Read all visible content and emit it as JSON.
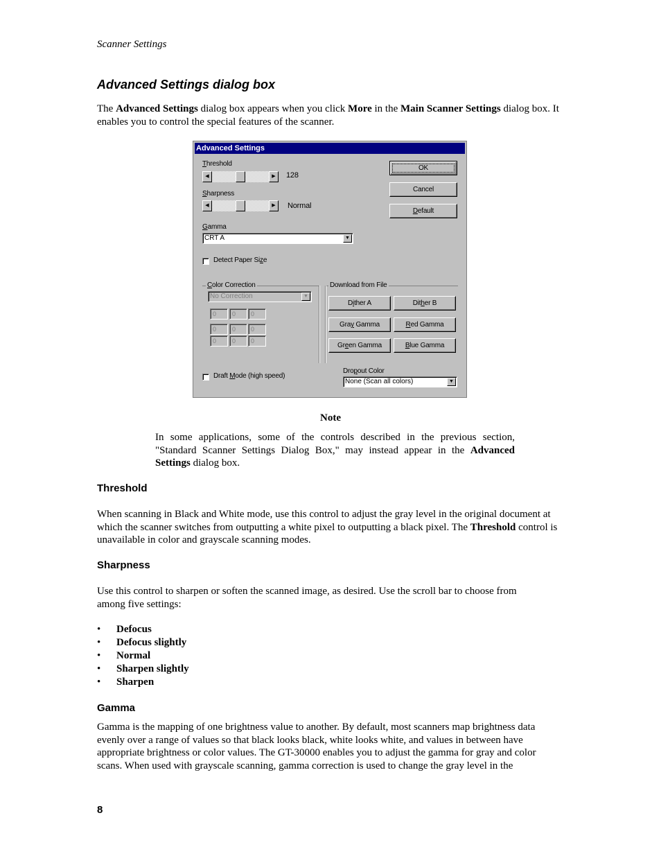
{
  "page": {
    "running_head": "Scanner Settings",
    "section_title": "Advanced Settings dialog box",
    "intro": {
      "p1": "The ",
      "b1": "Advanced Settings",
      "p2": " dialog box appears when you click ",
      "b2": "More",
      "p3": " in the ",
      "b3": "Main Scanner Settings",
      "p4": " dialog box. It enables you to control the special features of the scanner."
    },
    "note": {
      "title": "Note",
      "p1": "In some applications, some of the controls described in the previous section, \"Standard Scanner Settings Dialog Box,\" may instead appear in the ",
      "b1": "Advanced Settings",
      "p2": " dialog box."
    },
    "threshold": {
      "heading": "Threshold",
      "p1": "When scanning in Black and White mode, use this control to adjust the gray level in the original document at which the scanner switches from outputting a white pixel to outputting a black pixel. The ",
      "b1": "Threshold",
      "p2": " control is unavailable in color and grayscale scanning modes."
    },
    "sharpness": {
      "heading": "Sharpness",
      "text": "Use this control to sharpen or soften the scanned image, as desired. Use the scroll bar to choose from among five settings:",
      "options": [
        "Defocus",
        "Defocus slightly",
        "Normal",
        "Sharpen slightly",
        "Sharpen"
      ]
    },
    "gamma": {
      "heading": "Gamma",
      "text": "Gamma is the mapping of one brightness value to another. By default, most scanners map brightness data evenly over a range of values so that black looks black, white looks white, and values in between have appropriate brightness or color values. The GT-30000 enables you to adjust the gamma for gray and color scans. When used with grayscale scanning, gamma correction is used to change the gray level in the"
    },
    "page_number": "8"
  },
  "dialog": {
    "title": "Advanced Settings",
    "title_bar_color": "#000080",
    "face_color": "#c0c0c0",
    "threshold": {
      "label_u": "T",
      "label_rest": "hreshold",
      "value": "128",
      "position_fraction": 0.5
    },
    "sharpness": {
      "label_u": "S",
      "label_rest": "harpness",
      "value": "Normal",
      "position_fraction": 0.5
    },
    "gamma": {
      "label_u": "G",
      "label_rest": "amma",
      "selected": "CRT A"
    },
    "detect_paper_size": {
      "label_pre": "Detect Paper Si",
      "label_u": "z",
      "label_post": "e",
      "checked": false
    },
    "buttons": {
      "ok": "OK",
      "cancel": "Cancel",
      "default_u": "D",
      "default_rest": "efault"
    },
    "color_correction": {
      "label_u": "C",
      "label_rest": "olor Correction",
      "selected": "No Correction",
      "matrix": [
        [
          "0",
          "0",
          "0"
        ],
        [
          "0",
          "0",
          "0"
        ],
        [
          "0",
          "0",
          "0"
        ]
      ]
    },
    "download_from_file": {
      "label": "Download from File",
      "dither_a": {
        "pre": "D",
        "u": "i",
        "post": "ther A"
      },
      "dither_b": {
        "pre": "Dit",
        "u": "h",
        "post": "er B"
      },
      "gray_gamma": {
        "pre": "Gra",
        "u": "y",
        "post": " Gamma"
      },
      "red_gamma": {
        "pre": "",
        "u": "R",
        "post": "ed Gamma"
      },
      "green_gamma": {
        "pre": "Gr",
        "u": "e",
        "post": "en Gamma"
      },
      "blue_gamma": {
        "pre": "",
        "u": "B",
        "post": "lue Gamma"
      }
    },
    "draft_mode": {
      "label_pre": "Draft ",
      "label_u": "M",
      "label_post": "ode (high speed)",
      "checked": false
    },
    "dropout_color": {
      "label_pre": "Dro",
      "label_u": "p",
      "label_post": "out Color",
      "selected": "None (Scan all colors)"
    }
  }
}
